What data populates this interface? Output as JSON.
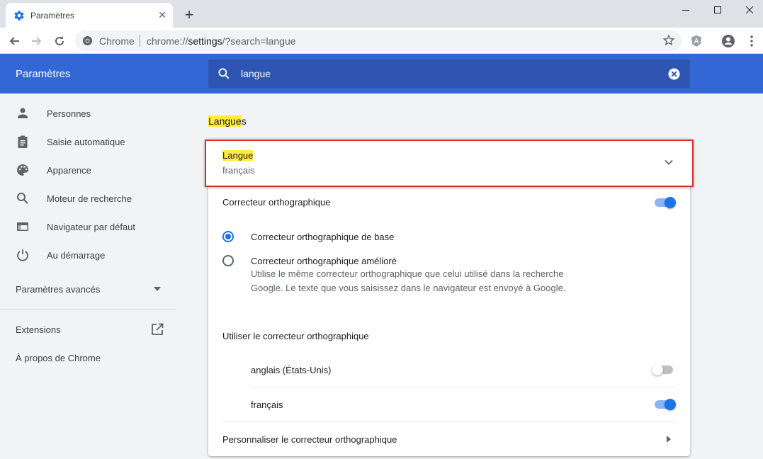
{
  "tab": {
    "title": "Paramètres",
    "close_glyph": "✕",
    "new_tab_glyph": "+"
  },
  "window_controls": {
    "minimize": "—",
    "maximize": "☐",
    "close": "✕"
  },
  "omnibox": {
    "scheme": "Chrome",
    "url_prefix": "chrome://",
    "url_host": "settings",
    "url_path": "/?search=langue"
  },
  "header": {
    "title": "Paramètres",
    "search_value": "langue"
  },
  "sidebar": {
    "items": [
      {
        "label": "Personnes",
        "icon": "person-icon"
      },
      {
        "label": "Saisie automatique",
        "icon": "clipboard-icon"
      },
      {
        "label": "Apparence",
        "icon": "palette-icon"
      },
      {
        "label": "Moteur de recherche",
        "icon": "search-icon"
      },
      {
        "label": "Navigateur par défaut",
        "icon": "browser-icon"
      },
      {
        "label": "Au démarrage",
        "icon": "power-icon"
      }
    ],
    "advanced": "Paramètres avancés",
    "extensions": "Extensions",
    "about": "À propos de Chrome"
  },
  "main": {
    "section_title_highlight": "Langue",
    "section_title_rest": "s",
    "language_label": "Langue",
    "language_value": "français",
    "spellcheck_label": "Correcteur orthographique",
    "spellcheck_enabled": true,
    "basic_label": "Correcteur orthographique de base",
    "basic_selected": true,
    "enhanced_label": "Correcteur orthographique amélioré",
    "enhanced_desc": "Utilise le même correcteur orthographique que celui utilisé dans la recherche Google. Le texte que vous saisissez dans le navigateur est envoyé à Google.",
    "enhanced_selected": false,
    "use_spellcheck_for": "Utiliser le correcteur orthographique",
    "spell_languages": [
      {
        "label": "anglais (États-Unis)",
        "enabled": false
      },
      {
        "label": "français",
        "enabled": true
      }
    ],
    "customize_label": "Personnaliser le correcteur orthographique"
  },
  "colors": {
    "header_blue": "#3367d6",
    "accent": "#1a73e8",
    "highlight": "#ffeb3b",
    "outline_red": "#d32f2f"
  }
}
